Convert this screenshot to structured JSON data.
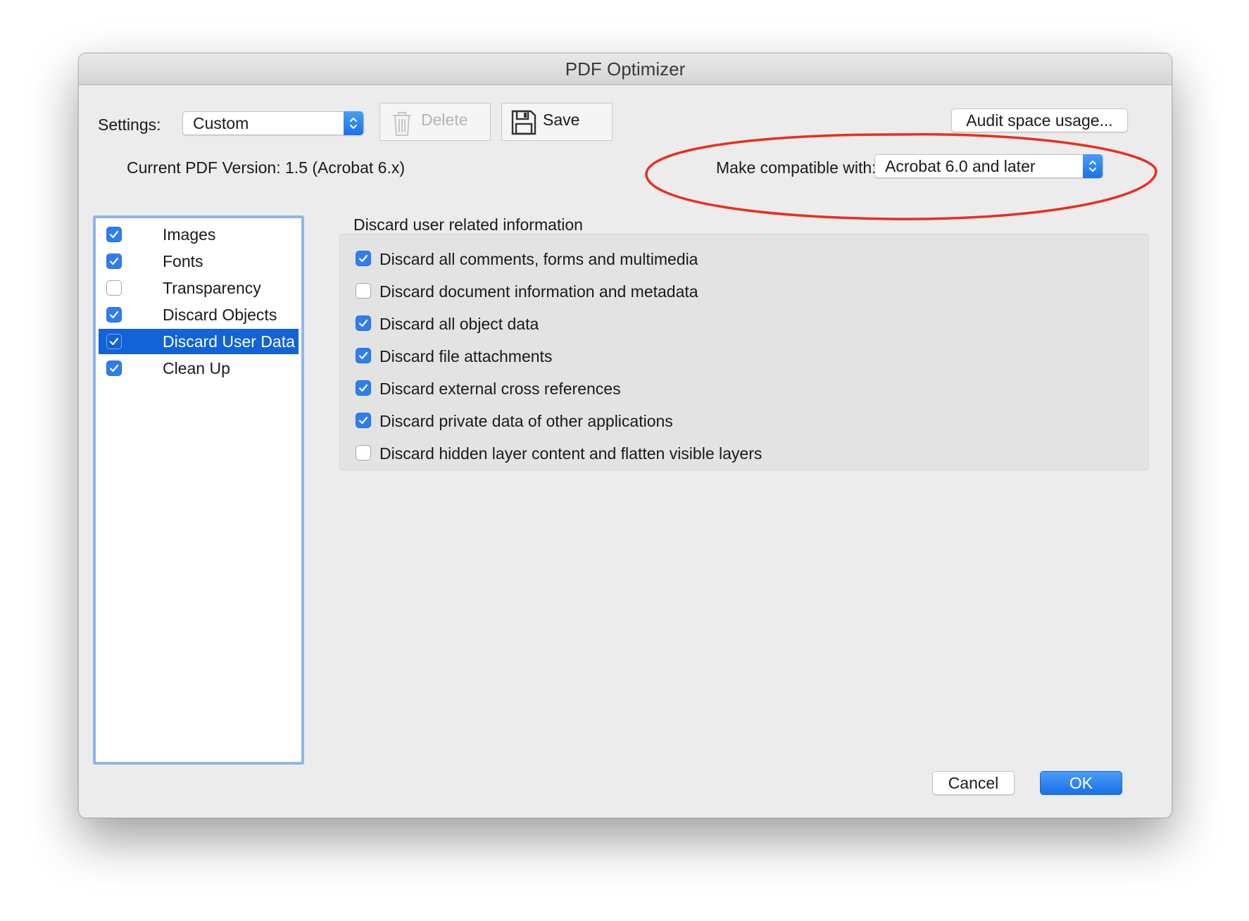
{
  "window": {
    "title": "PDF Optimizer"
  },
  "toolbar": {
    "settings_label": "Settings:",
    "settings_value": "Custom",
    "delete_label": "Delete",
    "save_label": "Save",
    "audit_label": "Audit space usage..."
  },
  "version": {
    "current": "Current PDF Version: 1.5 (Acrobat 6.x)",
    "compat_label": "Make compatible with:",
    "compat_value": "Acrobat 6.0 and later"
  },
  "sidebar": {
    "items": [
      {
        "label": "Images",
        "checked": true,
        "selected": false
      },
      {
        "label": "Fonts",
        "checked": true,
        "selected": false
      },
      {
        "label": "Transparency",
        "checked": false,
        "selected": false
      },
      {
        "label": "Discard Objects",
        "checked": true,
        "selected": false
      },
      {
        "label": "Discard User Data",
        "checked": true,
        "selected": true
      },
      {
        "label": "Clean Up",
        "checked": true,
        "selected": false
      }
    ]
  },
  "panel": {
    "title": "Discard user related information",
    "options": [
      {
        "label": "Discard all comments, forms and multimedia",
        "checked": true
      },
      {
        "label": "Discard document information and metadata",
        "checked": false
      },
      {
        "label": "Discard all object data",
        "checked": true
      },
      {
        "label": "Discard file attachments",
        "checked": true
      },
      {
        "label": "Discard external cross references",
        "checked": true
      },
      {
        "label": "Discard private data of other applications",
        "checked": true
      },
      {
        "label": "Discard hidden layer content and flatten visible layers",
        "checked": false
      }
    ]
  },
  "footer": {
    "cancel_label": "Cancel",
    "ok_label": "OK"
  },
  "colors": {
    "accent": "#1f74ea",
    "selection": "#1262d8",
    "annotation": "#e8301f"
  }
}
